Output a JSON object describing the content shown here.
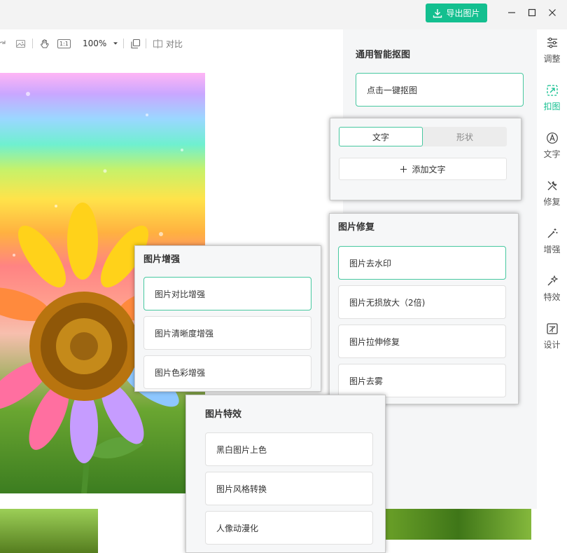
{
  "window": {
    "export_label": "导出图片"
  },
  "toolbar": {
    "zoom": "100%",
    "compare_label": "对比",
    "ratio_label": "1:1"
  },
  "cutout_panel": {
    "title": "通用智能抠图",
    "one_click_label": "点击一键抠图"
  },
  "rail": {
    "items": [
      {
        "label": "调整",
        "icon": "sliders-icon"
      },
      {
        "label": "扣图",
        "icon": "cutout-icon"
      },
      {
        "label": "文字",
        "icon": "text-circle-icon"
      },
      {
        "label": "修复",
        "icon": "repair-tools-icon"
      },
      {
        "label": "增强",
        "icon": "magic-wand-icon"
      },
      {
        "label": "特效",
        "icon": "sparkle-wand-icon"
      },
      {
        "label": "设计",
        "icon": "design-icon"
      }
    ],
    "active_index": 1
  },
  "text_popup": {
    "tabs": [
      "文字",
      "形状"
    ],
    "active_tab": 0,
    "add_label": "添加文字"
  },
  "repair_popup": {
    "title": "图片修复",
    "options": [
      "图片去水印",
      "图片无损放大（2倍)",
      "图片拉伸修复",
      "图片去雾"
    ],
    "selected": 0
  },
  "enhance_popup": {
    "title": "图片增强",
    "options": [
      "图片对比增强",
      "图片清晰度增强",
      "图片色彩增强"
    ],
    "selected": 0
  },
  "effects_popup": {
    "title": "图片特效",
    "options": [
      "黑白图片上色",
      "图片风格转换",
      "人像动漫化"
    ]
  },
  "colors": {
    "accent": "#13bf8f",
    "accent_border": "#48c8a0"
  }
}
